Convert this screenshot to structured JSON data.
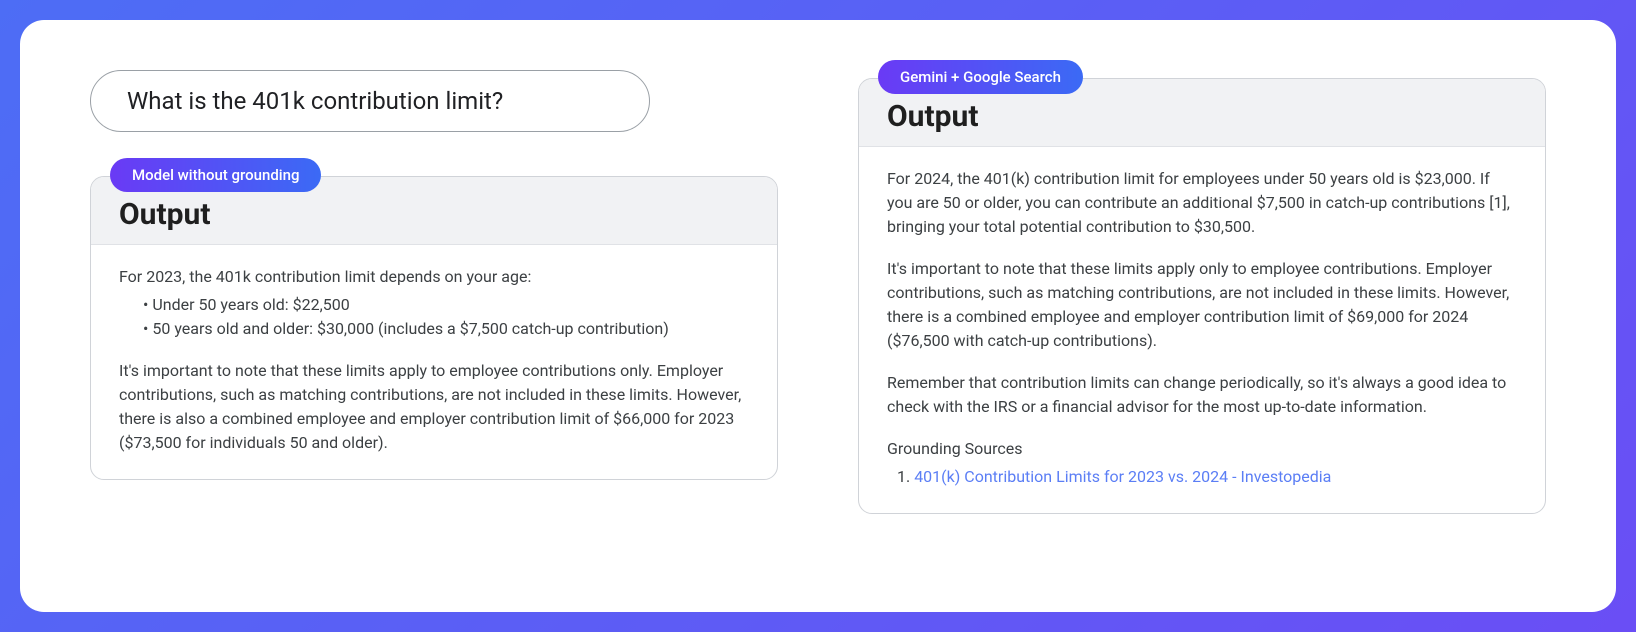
{
  "prompt": "What is the 401k contribution limit?",
  "left": {
    "badge": "Model without grounding",
    "title": "Output",
    "intro": "For 2023, the 401k contribution limit depends on your age:",
    "bullets": [
      "• Under 50 years old: $22,500",
      "• 50 years old and older: $30,000 (includes a $7,500 catch-up contribution)"
    ],
    "p2": "It's important to note that these limits apply to employee contributions only. Employer contributions, such as matching contributions, are not included in these limits. However, there is also a combined employee and employer contribution limit of $66,000 for 2023 ($73,500 for individuals 50 and older)."
  },
  "right": {
    "badge": "Gemini + Google Search",
    "title": "Output",
    "p1": "For 2024, the 401(k) contribution limit for employees under 50 years old is $23,000. If you are 50 or older, you can contribute an additional $7,500 in catch-up contributions [1], bringing your total potential contribution to $30,500.",
    "p2": "It's important to note that these limits apply only to employee contributions. Employer contributions, such as matching contributions, are not included in these limits. However, there is a combined employee and employer contribution limit of $69,000 for 2024 ($76,500 with catch-up contributions).",
    "p3": "Remember that contribution limits can change periodically, so it's always a good idea to check with the IRS or a financial advisor for the most up-to-date information.",
    "sources_label": "Grounding Sources",
    "source_num": "1.",
    "source_link": "401(k) Contribution Limits for 2023 vs. 2024 - Investopedia"
  }
}
